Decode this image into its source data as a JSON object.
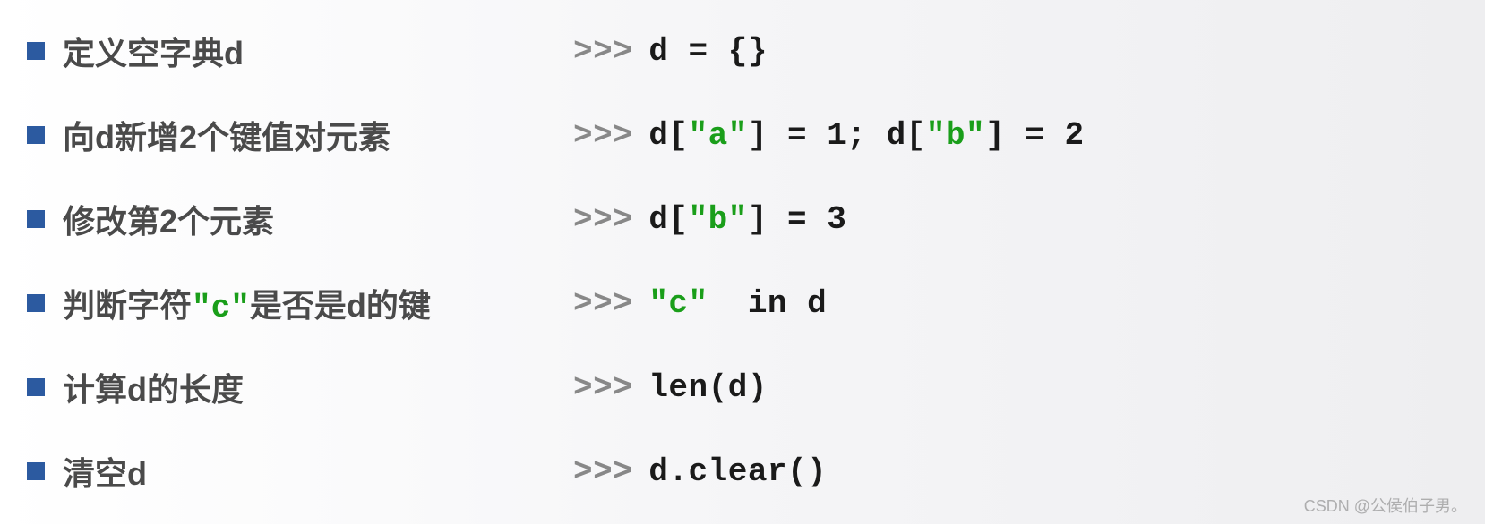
{
  "rows": [
    {
      "label_pre": "定义空字典d",
      "label_green": "",
      "label_post": "",
      "prompt": ">>>",
      "code": [
        {
          "t": "d = {}",
          "c": "plain"
        }
      ]
    },
    {
      "label_pre": "向d新增2个键值对元素",
      "label_green": "",
      "label_post": "",
      "prompt": ">>>",
      "code": [
        {
          "t": "d[",
          "c": "plain"
        },
        {
          "t": "\"a\"",
          "c": "green"
        },
        {
          "t": "] = 1; d[",
          "c": "plain"
        },
        {
          "t": "\"b\"",
          "c": "green"
        },
        {
          "t": "] = 2",
          "c": "plain"
        }
      ]
    },
    {
      "label_pre": "修改第2个元素",
      "label_green": "",
      "label_post": "",
      "prompt": ">>>",
      "code": [
        {
          "t": "d[",
          "c": "plain"
        },
        {
          "t": "\"b\"",
          "c": "green"
        },
        {
          "t": "] = 3",
          "c": "plain"
        }
      ]
    },
    {
      "label_pre": "判断字符",
      "label_green": "\"c\"",
      "label_post": "是否是d的键",
      "prompt": ">>>",
      "code": [
        {
          "t": "\"c\"",
          "c": "green"
        },
        {
          "t": "  in d",
          "c": "plain"
        }
      ]
    },
    {
      "label_pre": "计算d的长度",
      "label_green": "",
      "label_post": "",
      "prompt": ">>>",
      "code": [
        {
          "t": "len(d)",
          "c": "plain"
        }
      ]
    },
    {
      "label_pre": "清空d",
      "label_green": "",
      "label_post": "",
      "prompt": ">>>",
      "code": [
        {
          "t": "d.clear()",
          "c": "plain"
        }
      ]
    }
  ],
  "watermark": "CSDN @公侯伯子男。"
}
